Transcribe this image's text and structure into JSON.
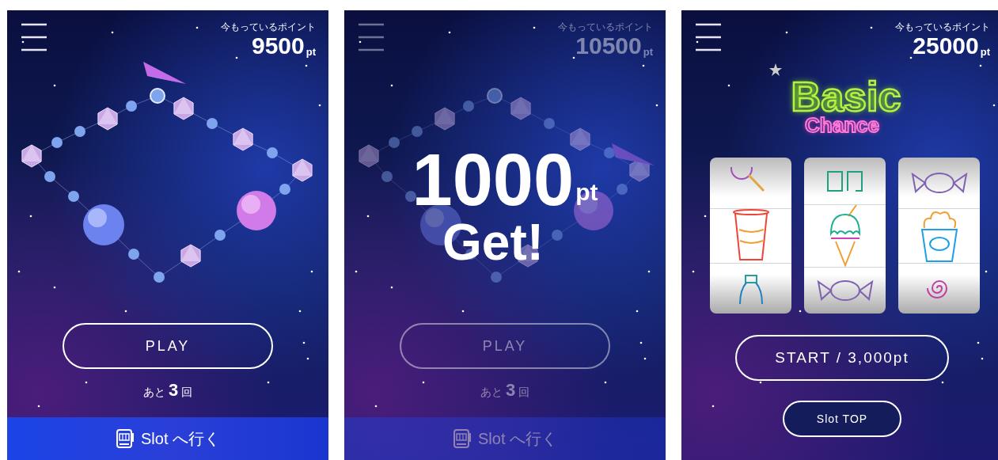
{
  "screens": [
    {
      "kind": "board",
      "dimmed": false,
      "points_label": "今もっているポイント",
      "points": "9500",
      "points_unit": "pt",
      "play_button": "PLAY",
      "remaining": "あと **3** 回",
      "slot_link": "Slot へ行く"
    },
    {
      "kind": "board",
      "dimmed": true,
      "points_label": "今もっているポイント",
      "points": "10500",
      "points_unit": "pt",
      "play_button": "PLAY",
      "remaining": "あと **3** 回",
      "slot_link": "Slot へ行く",
      "reward": {
        "amount": "1000",
        "unit": "pt",
        "message": "Get!"
      }
    },
    {
      "kind": "slot",
      "dimmed": false,
      "points_label": "今もっているポイント",
      "points": "25000",
      "points_unit": "pt",
      "title": "Basic",
      "subtitle": "Chance",
      "start_button": "START / 3,000pt",
      "top_button": "Slot TOP"
    }
  ]
}
